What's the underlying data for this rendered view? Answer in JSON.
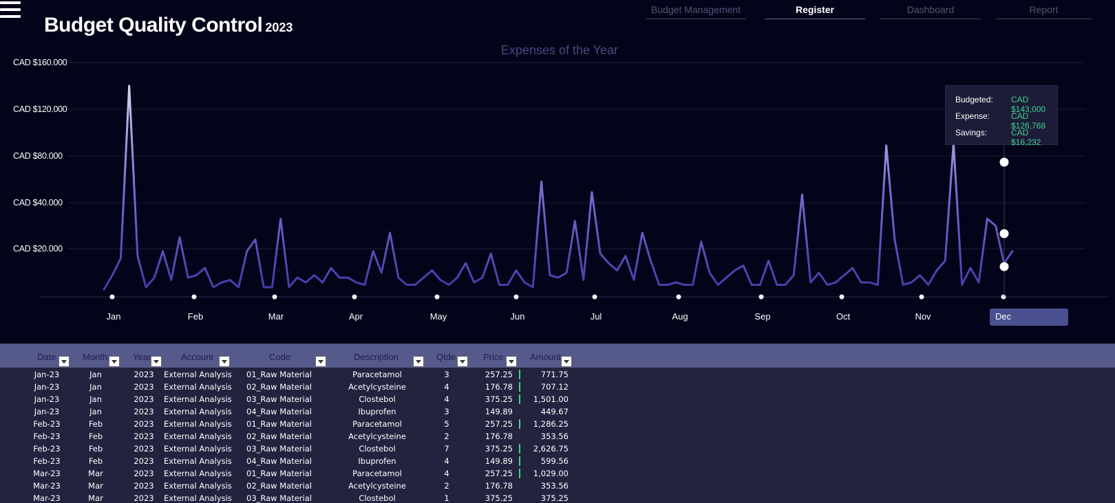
{
  "header": {
    "title": "Budget Quality Control",
    "year": "2023",
    "nav": [
      "Budget Management",
      "Register",
      "Dashboard",
      "Report"
    ],
    "active_nav": "Register"
  },
  "colors": {
    "background": "#03031a",
    "line_top": "#d6d6ee",
    "line_bottom": "#4a3aa8",
    "accent_green": "#3dd48f",
    "table_header": "#555a8a",
    "month_highlight": "#4a4f90"
  },
  "chart_data": {
    "type": "line",
    "title": "Expenses of the Year",
    "xlabel": "",
    "ylabel": "",
    "y_tick_labels": [
      "CAD $160.000",
      "CAD $120.000",
      "CAD $80.000",
      "CAD $40.000",
      "CAD $20.000"
    ],
    "y_tick_values": [
      160000,
      120000,
      80000,
      40000,
      20000
    ],
    "x_labels": [
      "Jan",
      "Feb",
      "Mar",
      "Apr",
      "May",
      "Jun",
      "Jul",
      "Aug",
      "Sep",
      "Oct",
      "Nov",
      "Dec"
    ],
    "selected_month": "Dec",
    "grid": true,
    "series": [
      {
        "values": [
          3000,
          9000,
          16000,
          140000,
          17000,
          4000,
          8000,
          19000,
          7000,
          25000,
          8000,
          9000,
          12000,
          4000,
          6000,
          7000,
          4000,
          19000,
          24000,
          4000,
          4000,
          33000,
          4000,
          8000,
          6000,
          9000,
          6000,
          12000,
          8000,
          8000,
          6000,
          5000,
          19000,
          10000,
          27000,
          8000,
          5000,
          5000,
          8000,
          11000,
          7000,
          5000,
          8000,
          14000,
          6000,
          8000,
          18000,
          5000,
          5000,
          11000,
          6000,
          4000,
          58000,
          9000,
          8000,
          10000,
          32000,
          7000,
          49000,
          18000,
          14000,
          11000,
          17000,
          7000,
          27000,
          15000,
          5000,
          5000,
          6000,
          5000,
          5000,
          23000,
          10000,
          5000,
          8000,
          11000,
          13000,
          5000,
          5000,
          15000,
          5000,
          5000,
          9000,
          47000,
          6000,
          10000,
          5000,
          6000,
          9000,
          12000,
          6000,
          6000,
          5000,
          89000,
          24000,
          5000,
          6000,
          9000,
          5000,
          11000,
          15000,
          91000,
          5000,
          12000,
          6000,
          33000,
          30000,
          14000,
          19000
        ]
      }
    ],
    "tooltip": {
      "budgeted_label": "Budgeted:",
      "budgeted_value": "CAD $143,000",
      "expense_label": "Expense:",
      "expense_value": "CAD $126,768",
      "savings_label": "Savings:",
      "savings_value": "CAD $16,232"
    }
  },
  "table": {
    "columns": [
      "Date",
      "Month",
      "Year",
      "Account",
      "Code",
      "Description",
      "Qtde",
      "Price",
      "Amount"
    ],
    "rows": [
      {
        "date": "Jan-23",
        "month": "Jan",
        "year": "2023",
        "account": "External Analysis",
        "code": "01_Raw Material",
        "description": "Paracetamol",
        "qtde": "3",
        "price": "257.25",
        "amount": "771.75",
        "bar": 0.33
      },
      {
        "date": "Jan-23",
        "month": "Jan",
        "year": "2023",
        "account": "External Analysis",
        "code": "02_Raw Material",
        "description": "Acetylcysteine",
        "qtde": "4",
        "price": "176.78",
        "amount": "707.12",
        "bar": 0.3
      },
      {
        "date": "Jan-23",
        "month": "Jan",
        "year": "2023",
        "account": "External Analysis",
        "code": "03_Raw Material",
        "description": "Clostebol",
        "qtde": "4",
        "price": "375.25",
        "amount": "1,501.00",
        "bar": 0.6
      },
      {
        "date": "Jan-23",
        "month": "Jan",
        "year": "2023",
        "account": "External Analysis",
        "code": "04_Raw Material",
        "description": "Ibuprofen",
        "qtde": "3",
        "price": "149.89",
        "amount": "449.67",
        "bar": 0
      },
      {
        "date": "Feb-23",
        "month": "Feb",
        "year": "2023",
        "account": "External Analysis",
        "code": "01_Raw Material",
        "description": "Paracetamol",
        "qtde": "5",
        "price": "257.25",
        "amount": "1,286.25",
        "bar": 0.5
      },
      {
        "date": "Feb-23",
        "month": "Feb",
        "year": "2023",
        "account": "External Analysis",
        "code": "02_Raw Material",
        "description": "Acetylcysteine",
        "qtde": "2",
        "price": "176.78",
        "amount": "353.56",
        "bar": 0
      },
      {
        "date": "Feb-23",
        "month": "Feb",
        "year": "2023",
        "account": "External Analysis",
        "code": "03_Raw Material",
        "description": "Clostebol",
        "qtde": "7",
        "price": "375.25",
        "amount": "2,626.75",
        "bar": 1
      },
      {
        "date": "Feb-23",
        "month": "Feb",
        "year": "2023",
        "account": "External Analysis",
        "code": "04_Raw Material",
        "description": "Ibuprofen",
        "qtde": "4",
        "price": "149.89",
        "amount": "599.56",
        "bar": 0.25
      },
      {
        "date": "Mar-23",
        "month": "Mar",
        "year": "2023",
        "account": "External Analysis",
        "code": "01_Raw Material",
        "description": "Paracetamol",
        "qtde": "4",
        "price": "257.25",
        "amount": "1,029.00",
        "bar": 0.4
      },
      {
        "date": "Mar-23",
        "month": "Mar",
        "year": "2023",
        "account": "External Analysis",
        "code": "02_Raw Material",
        "description": "Acetylcysteine",
        "qtde": "2",
        "price": "176.78",
        "amount": "353.56",
        "bar": 0
      },
      {
        "date": "Mar-23",
        "month": "Mar",
        "year": "2023",
        "account": "External Analysis",
        "code": "03_Raw Material",
        "description": "Clostebol",
        "qtde": "1",
        "price": "375.25",
        "amount": "375.25",
        "bar": 0
      }
    ]
  }
}
